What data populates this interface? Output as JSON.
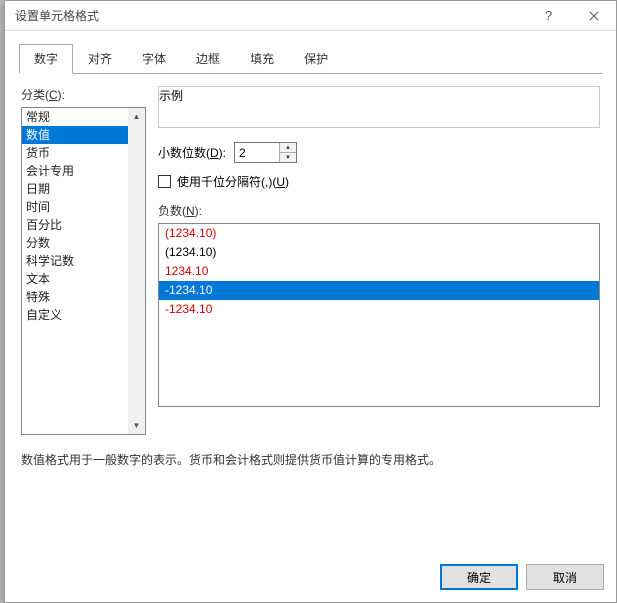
{
  "window": {
    "title": "设置单元格格式",
    "help_tooltip": "?",
    "close_tooltip": "×"
  },
  "tabs": [
    {
      "label": "数字",
      "active": true
    },
    {
      "label": "对齐",
      "active": false
    },
    {
      "label": "字体",
      "active": false
    },
    {
      "label": "边框",
      "active": false
    },
    {
      "label": "填充",
      "active": false
    },
    {
      "label": "保护",
      "active": false
    }
  ],
  "categoryLabel": "分类(C):",
  "categories": [
    {
      "label": "常规",
      "selected": false
    },
    {
      "label": "数值",
      "selected": true
    },
    {
      "label": "货币",
      "selected": false
    },
    {
      "label": "会计专用",
      "selected": false
    },
    {
      "label": "日期",
      "selected": false
    },
    {
      "label": "时间",
      "selected": false
    },
    {
      "label": "百分比",
      "selected": false
    },
    {
      "label": "分数",
      "selected": false
    },
    {
      "label": "科学记数",
      "selected": false
    },
    {
      "label": "文本",
      "selected": false
    },
    {
      "label": "特殊",
      "selected": false
    },
    {
      "label": "自定义",
      "selected": false
    }
  ],
  "exampleLabel": "示例",
  "decimalLabel": "小数位数(D):",
  "decimalValue": "2",
  "thousandsLabel": "使用千位分隔符(,)(U)",
  "thousandsChecked": false,
  "negativeLabel": "负数(N):",
  "negativeFormats": [
    {
      "text": "(1234.10)",
      "red": true,
      "selected": false
    },
    {
      "text": "(1234.10)",
      "red": false,
      "selected": false
    },
    {
      "text": "1234.10",
      "red": true,
      "selected": false
    },
    {
      "text": "-1234.10",
      "red": false,
      "selected": true
    },
    {
      "text": "-1234.10",
      "red": true,
      "selected": false
    }
  ],
  "description": "数值格式用于一般数字的表示。货币和会计格式则提供货币值计算的专用格式。",
  "buttons": {
    "ok": "确定",
    "cancel": "取消"
  },
  "colors": {
    "accent": "#0078d7",
    "negativeRed": "#d20000"
  }
}
